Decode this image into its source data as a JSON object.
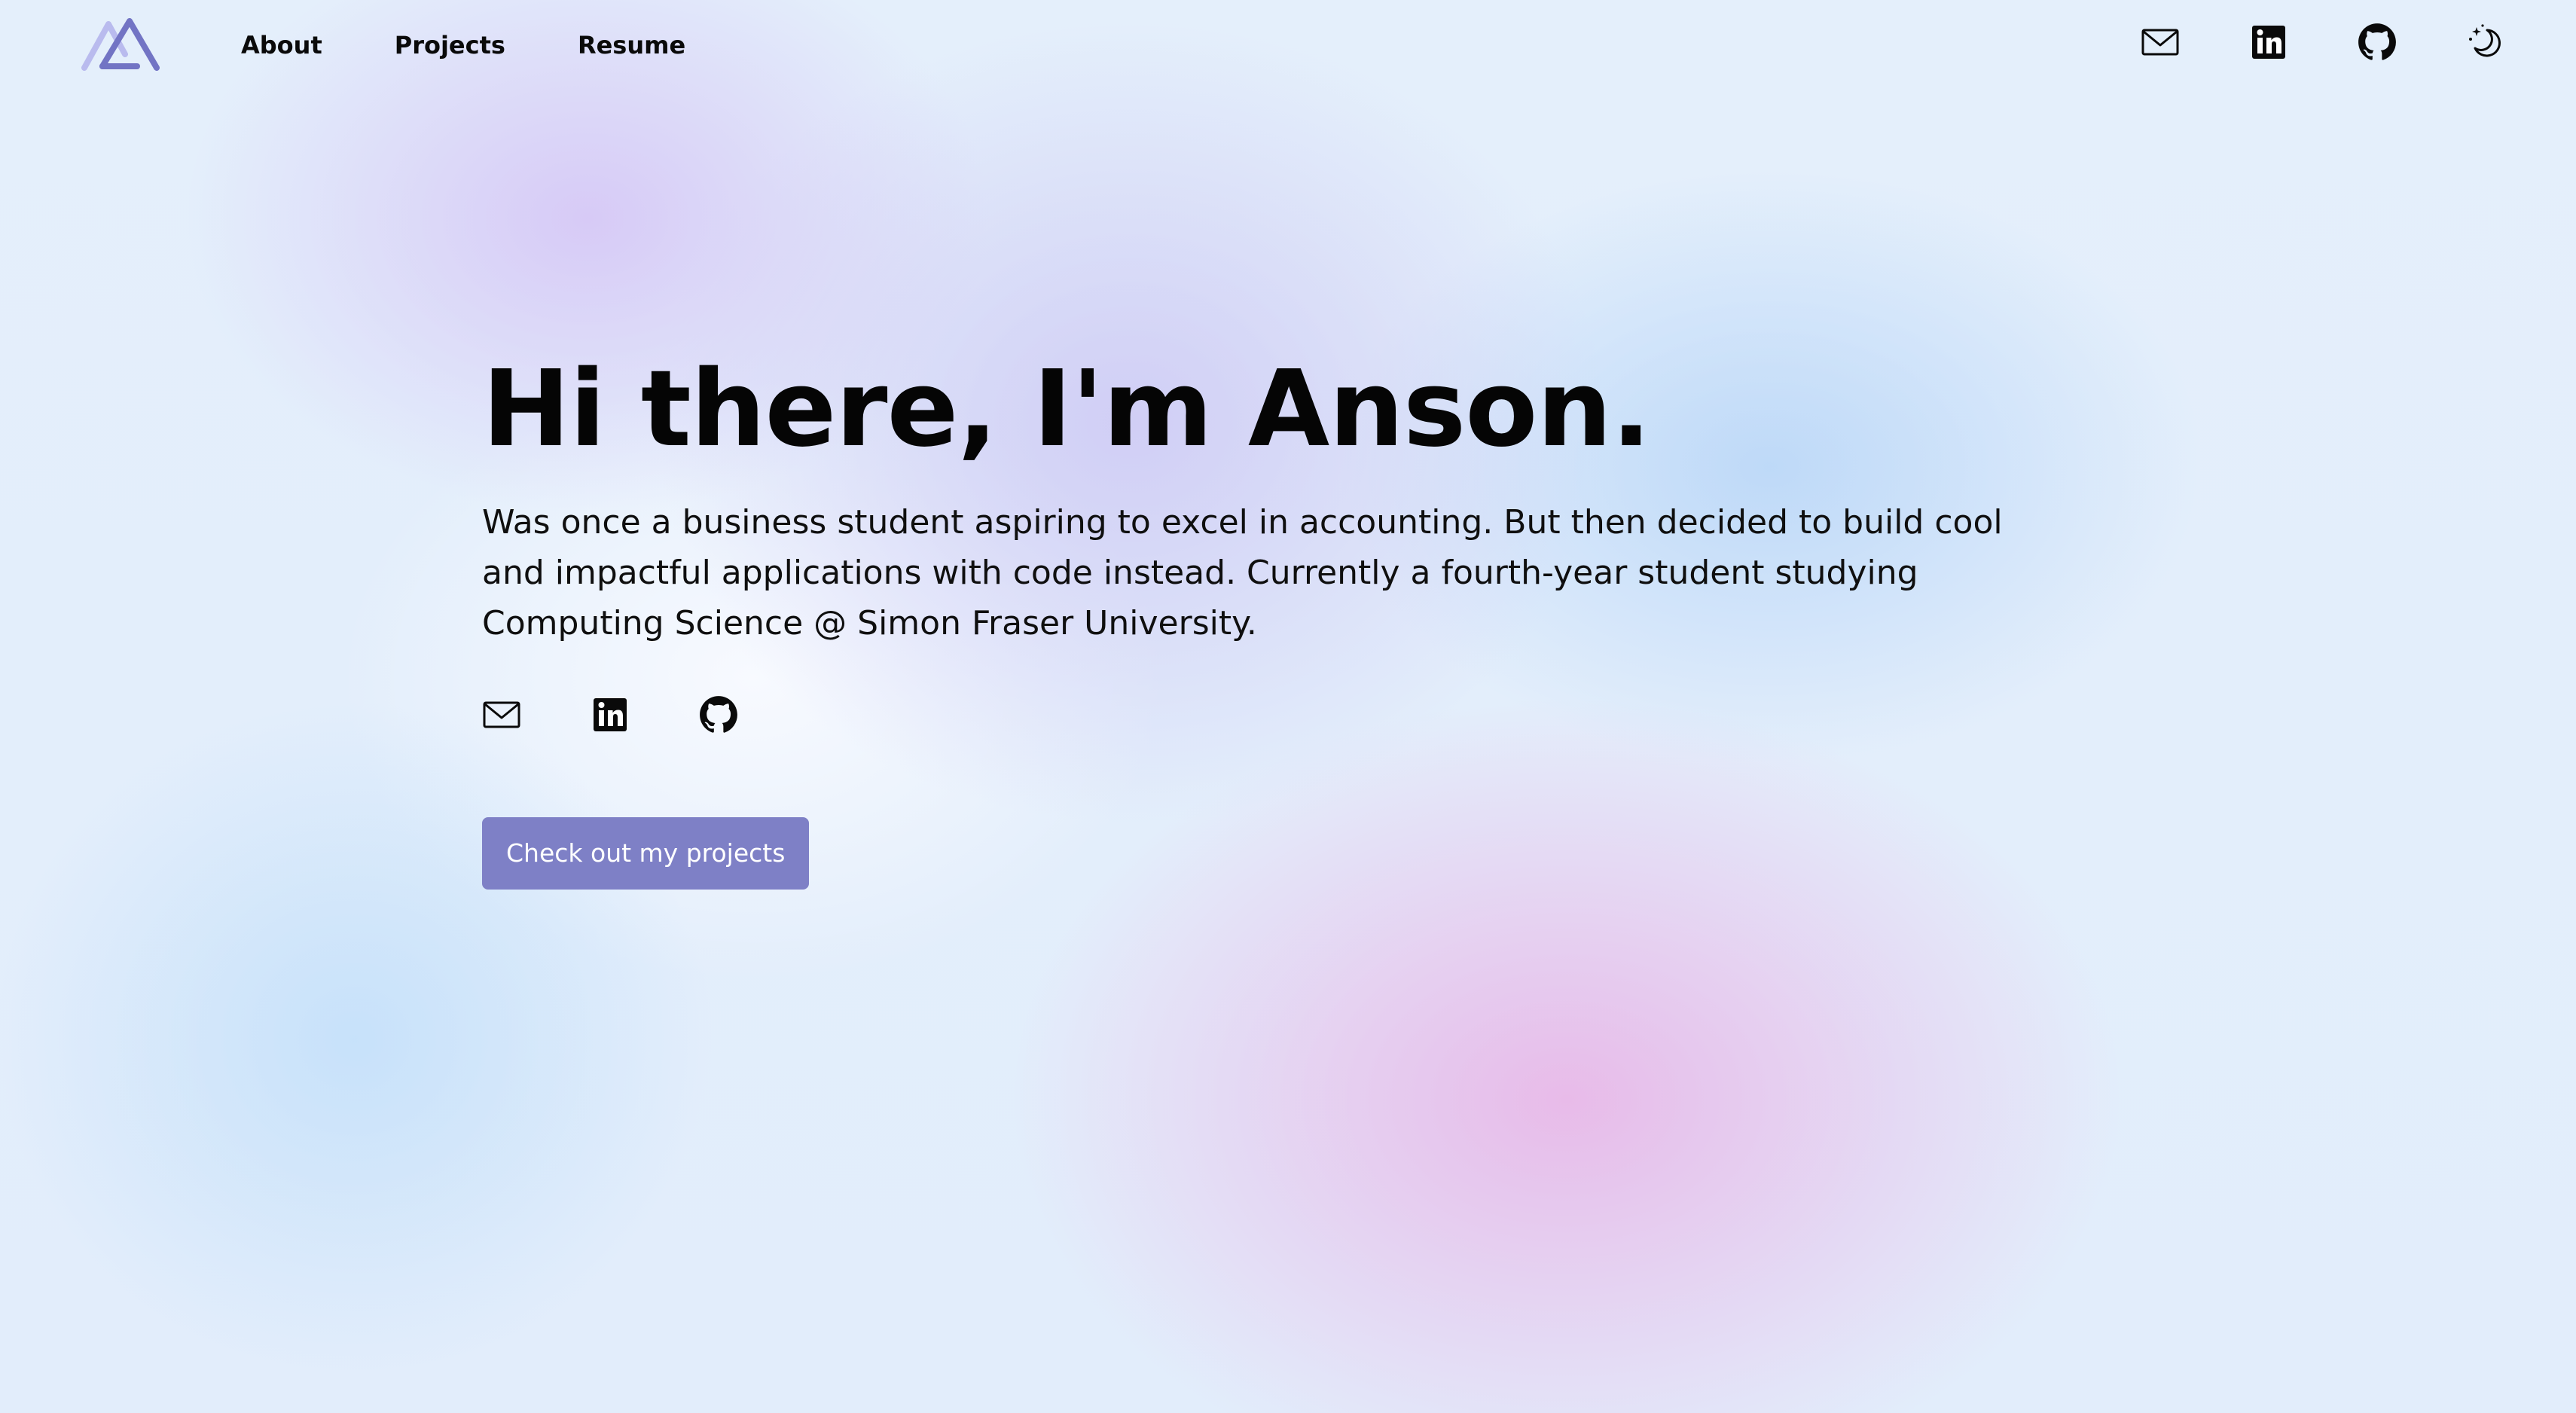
{
  "nav": {
    "logo_icon": "mountain-logo-icon",
    "links": [
      "About",
      "Projects",
      "Resume"
    ],
    "icons": [
      "mail-icon",
      "linkedin-icon",
      "github-icon",
      "theme-toggle-moon-icon"
    ]
  },
  "hero": {
    "title": "Hi there, I'm Anson.",
    "description": "Was once a business student aspiring to excel in accounting. But then decided to build cool and impactful applications with code instead. Currently a fourth-year student studying Computing Science @ Simon Fraser University.",
    "social_icons": [
      "mail-icon",
      "linkedin-icon",
      "github-icon"
    ],
    "cta_label": "Check out my projects"
  },
  "colors": {
    "accent": "#7e80c6",
    "logo_light": "#b7b8ec",
    "logo_dark": "#6f71c4",
    "text": "#0a0a0a"
  }
}
